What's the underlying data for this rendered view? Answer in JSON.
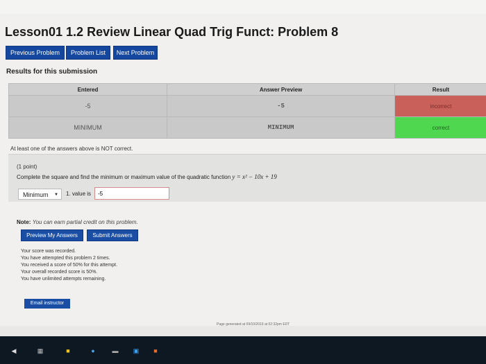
{
  "page": {
    "title": "Lesson01 1.2 Review Linear Quad Trig Funct: Problem 8",
    "nav": {
      "previous": "Previous Problem",
      "list": "Problem List",
      "next": "Next Problem"
    },
    "results_label": "Results for this submission",
    "table": {
      "headers": [
        "Entered",
        "Answer Preview",
        "Result"
      ],
      "rows": [
        {
          "entered": "-5",
          "preview": "-5",
          "result": "incorrect"
        },
        {
          "entered": "MINIMUM",
          "preview": "MINIMUM",
          "result": "correct"
        }
      ]
    },
    "warning": "At least one of the answers above is NOT correct.",
    "problem": {
      "points": "(1 point)",
      "question_text": "Complete the square and find the minimum or maximum value of the quadratic function",
      "formula": "y = x² − 10x + 19",
      "select_value": "Minimum",
      "value_label": "1. value is",
      "answer_value": "-5"
    },
    "note_label": "Note:",
    "note_text": "You can earn partial credit on this problem.",
    "buttons": {
      "preview": "Preview My Answers",
      "submit": "Submit Answers",
      "email": "Email instructor"
    },
    "status": [
      "Your score was recorded.",
      "You have attempted this problem 2 times.",
      "You received a score of 50% for this attempt.",
      "Your overall recorded score is 50%.",
      "You have unlimited attempts remaining."
    ],
    "footer": "Page generated at 09/10/2019 at 02:32pm EDT"
  },
  "colors": {
    "nav_button": "#16479e",
    "incorrect": "#c9605a",
    "correct": "#4fd84f"
  },
  "taskbar_icons": [
    "back-icon",
    "calculator-icon",
    "app-icon",
    "chrome-icon",
    "terminal-icon",
    "windows-icon",
    "powerpoint-icon"
  ]
}
